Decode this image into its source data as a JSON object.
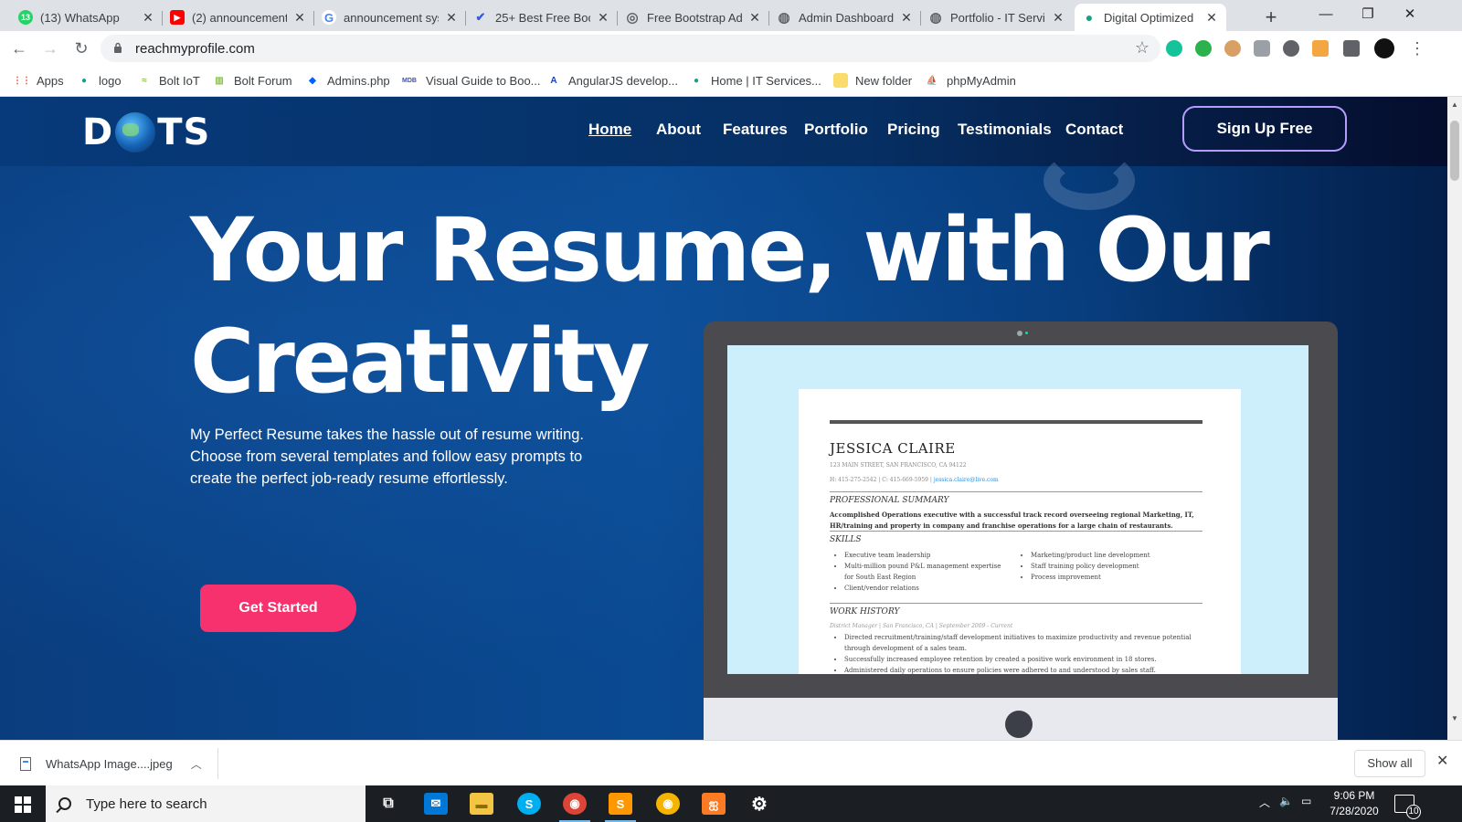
{
  "browser": {
    "tabs": [
      {
        "title": "(13) WhatsApp",
        "fav": "13",
        "favcolor": "#25d366",
        "icon": "whatsapp-icon"
      },
      {
        "title": "(2) announcement",
        "fav": "▶",
        "favcolor": "#ff0000",
        "icon": "youtube-icon"
      },
      {
        "title": "announcement sys",
        "fav": "G",
        "favcolor": "#4285f4",
        "icon": "google-icon"
      },
      {
        "title": "25+ Best Free Boo",
        "fav": "✔",
        "favcolor": "#3a5bd9",
        "icon": "checkmark-icon"
      },
      {
        "title": "Free Bootstrap Ad",
        "fav": "◎",
        "favcolor": "#5f6368",
        "icon": "bootstrap-icon"
      },
      {
        "title": "Admin Dashboard",
        "fav": "◍",
        "favcolor": "#5f6368",
        "icon": "globe-icon"
      },
      {
        "title": "Portfolio - IT Servic",
        "fav": "◍",
        "favcolor": "#5f6368",
        "icon": "globe-icon"
      },
      {
        "title": "Digital Optimized",
        "fav": "●",
        "favcolor": "#16a085",
        "icon": "site-icon"
      }
    ],
    "url": "reachmyprofile.com",
    "bookmarks": [
      {
        "label": "Apps",
        "icon": "apps-grid-icon",
        "color": "#ea4335",
        "glyph": "⋮⋮"
      },
      {
        "label": "logo",
        "icon": "logo-icon",
        "color": "#16a085",
        "glyph": "●"
      },
      {
        "label": "Bolt IoT",
        "icon": "bolt-iot-icon",
        "color": "#8bc34a",
        "glyph": "≈"
      },
      {
        "label": "Bolt Forum",
        "icon": "bolt-forum-icon",
        "color": "#8bc34a",
        "glyph": "▥"
      },
      {
        "label": "Admins.php",
        "icon": "dropbox-icon",
        "color": "#0061ff",
        "glyph": "◆"
      },
      {
        "label": "Visual Guide to Boo...",
        "icon": "mdb-icon",
        "color": "#3f51b5",
        "glyph": "MDB"
      },
      {
        "label": "AngularJS develop...",
        "icon": "angular-icon",
        "color": "#1a3fb5",
        "glyph": "A"
      },
      {
        "label": "Home | IT Services...",
        "icon": "site-icon",
        "color": "#16a085",
        "glyph": "●"
      },
      {
        "label": "New folder",
        "icon": "folder-icon",
        "color": "#f5c518",
        "glyph": "▭"
      },
      {
        "label": "phpMyAdmin",
        "icon": "phpmyadmin-icon",
        "color": "#f29111",
        "glyph": "⛵"
      }
    ]
  },
  "site": {
    "logo": {
      "left": "D",
      "right": "TS"
    },
    "nav": [
      "Home",
      "About",
      "Features",
      "Portfolio",
      "Pricing",
      "Testimonials",
      "Contact"
    ],
    "signup": "Sign Up Free",
    "hero_line1": "Your Resume, with Our",
    "hero_line2": "Creativity",
    "hero_text": "My Perfect Resume takes the hassle out of resume writing. Choose from several templates and follow easy prompts to create the perfect job-ready resume effortlessly.",
    "cta": "Get Started",
    "resume": {
      "name": "JESSICA CLAIRE",
      "address": "123 MAIN STREET, SAN FRANCISCO, CA 94122",
      "phone": "H: 415-275-2542 | C: 415-669-5959 | ",
      "email": "jessica.claire@live.com",
      "summary_heading": "PROFESSIONAL SUMMARY",
      "summary": "Accomplished Operations executive with a successful track record overseeing regional Marketing, IT, HR/training and property in company and franchise operations for a large chain of restaurants.",
      "skills_heading": "SKILLS",
      "skills_left": [
        "Executive team leadership",
        "Multi-million pound P&L management expertise",
        "for South East Region",
        "Client/vendor relations"
      ],
      "skills_right": [
        "Marketing/product line development",
        "Staff training policy development",
        "Process improvement"
      ],
      "work_heading": "WORK HISTORY",
      "job": "District Manager | San Francisco, CA | September 2009 - Current",
      "work_items": [
        "Directed recruitment/training/staff development initiatives to maximize productivity and revenue potential",
        "through development of a sales team.",
        "Successfully increased employee retention by created a positive work environment in 18 stores.",
        "Administered daily operations to ensure policies were adhered to and understood by sales staff."
      ]
    }
  },
  "downloads": {
    "file": "WhatsApp Image....jpeg",
    "show_all": "Show all"
  },
  "taskbar": {
    "search_placeholder": "Type here to search",
    "time": "9:06 PM",
    "date": "7/28/2020",
    "notifications": "10",
    "apps": [
      {
        "icon": "task-view-icon",
        "glyph": "⧉",
        "bg": "transparent"
      },
      {
        "icon": "mail-icon",
        "glyph": "✉",
        "bg": "#0078d7"
      },
      {
        "icon": "file-explorer-icon",
        "glyph": "▬",
        "bg": "#f4c542"
      },
      {
        "icon": "skype-icon",
        "glyph": "S",
        "bg": "#00aff0"
      },
      {
        "icon": "chrome-icon",
        "glyph": "◉",
        "bg": "#db4437"
      },
      {
        "icon": "sublime-icon",
        "glyph": "S",
        "bg": "#ff9800"
      },
      {
        "icon": "chrome-canary-icon",
        "glyph": "◉",
        "bg": "#f4b400"
      },
      {
        "icon": "xampp-icon",
        "glyph": "ஐ",
        "bg": "#fb7a24"
      },
      {
        "icon": "settings-icon",
        "glyph": "⚙",
        "bg": "transparent"
      }
    ]
  }
}
